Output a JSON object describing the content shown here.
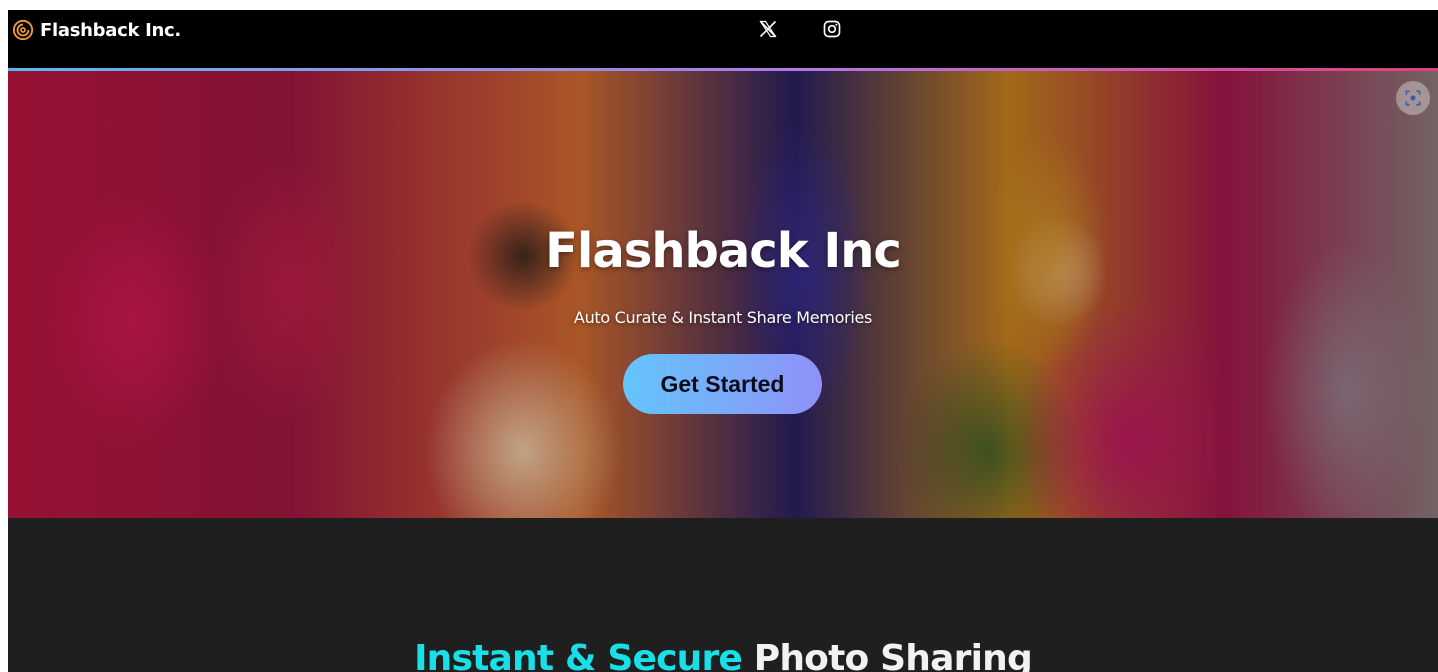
{
  "navbar": {
    "brand_name": "Flashback Inc.",
    "social_icons": [
      "x-icon",
      "instagram-icon"
    ]
  },
  "hero": {
    "title": "Flashback Inc",
    "subtitle": "Auto Curate & Instant Share Memories",
    "cta_label": "Get Started",
    "lens_icon": "visual-search-icon"
  },
  "section": {
    "title_highlight": "Instant & Secure",
    "title_rest": "Photo Sharing"
  },
  "colors": {
    "accent_cyan": "#19e0e8",
    "cta_start": "#64c5fb",
    "cta_end": "#8f91f8",
    "nav_bg": "#000000",
    "section_bg": "#1f1f1f"
  }
}
